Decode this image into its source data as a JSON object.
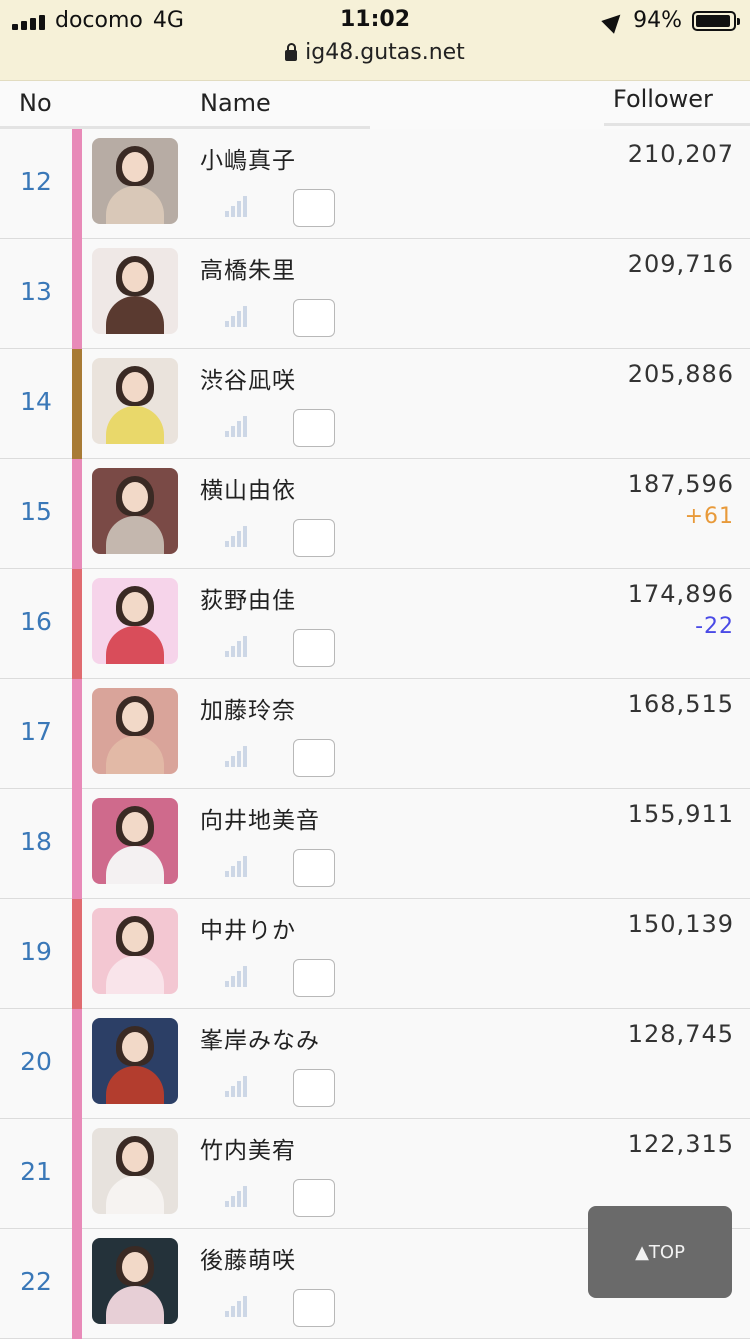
{
  "status_bar": {
    "carrier": "docomo",
    "network": "4G",
    "time": "11:02",
    "battery": "94%",
    "url": "ig48.gutas.net"
  },
  "table_header": {
    "no": "No",
    "name": "Name",
    "follower": "Follower"
  },
  "rows": [
    {
      "rank": "12",
      "name": "小嶋真子",
      "followers": "210,207",
      "diff": "",
      "bar_color": "#e88ab8",
      "photo_bg": "#b7aca4",
      "photo_body": "#d9c8b8"
    },
    {
      "rank": "13",
      "name": "高橋朱里",
      "followers": "209,716",
      "diff": "",
      "bar_color": "#e88ab8",
      "photo_bg": "#efe8e6",
      "photo_body": "#5a3a30"
    },
    {
      "rank": "14",
      "name": "渋谷凪咲",
      "followers": "205,886",
      "diff": "",
      "bar_color": "#a87b35",
      "photo_bg": "#eae3dc",
      "photo_body": "#e9d86a"
    },
    {
      "rank": "15",
      "name": "横山由依",
      "followers": "187,596",
      "diff": "+61",
      "diff_color": "#e89a3a",
      "bar_color": "#e88ab8",
      "photo_bg": "#7a4a46",
      "photo_body": "#c4b7ae"
    },
    {
      "rank": "16",
      "name": "荻野由佳",
      "followers": "174,896",
      "diff": "-22",
      "diff_color": "#4a4ae6",
      "bar_color": "#e06b70",
      "photo_bg": "#f6d4ea",
      "photo_body": "#d94d5a"
    },
    {
      "rank": "17",
      "name": "加藤玲奈",
      "followers": "168,515",
      "diff": "",
      "bar_color": "#e88ab8",
      "photo_bg": "#d9a49a",
      "photo_body": "#e2b9a6"
    },
    {
      "rank": "18",
      "name": "向井地美音",
      "followers": "155,911",
      "diff": "",
      "bar_color": "#e88ab8",
      "photo_bg": "#cf6a8c",
      "photo_body": "#f4f1f2"
    },
    {
      "rank": "19",
      "name": "中井りか",
      "followers": "150,139",
      "diff": "",
      "bar_color": "#e06b70",
      "photo_bg": "#f3c7d2",
      "photo_body": "#f9e4ea"
    },
    {
      "rank": "20",
      "name": "峯岸みなみ",
      "followers": "128,745",
      "diff": "",
      "bar_color": "#e88ab8",
      "photo_bg": "#2c3f66",
      "photo_body": "#b33d2e"
    },
    {
      "rank": "21",
      "name": "竹内美宥",
      "followers": "122,315",
      "diff": "",
      "bar_color": "#e88ab8",
      "photo_bg": "#e7e2dd",
      "photo_body": "#f6f3f1"
    },
    {
      "rank": "22",
      "name": "後藤萌咲",
      "followers": "",
      "diff": "",
      "bar_color": "#e88ab8",
      "photo_bg": "#24323a",
      "photo_body": "#e7cfd6"
    }
  ],
  "top_button": "▲TOP",
  "icons": {
    "chart": "bar-chart-icon",
    "checkbox": "checkbox"
  }
}
